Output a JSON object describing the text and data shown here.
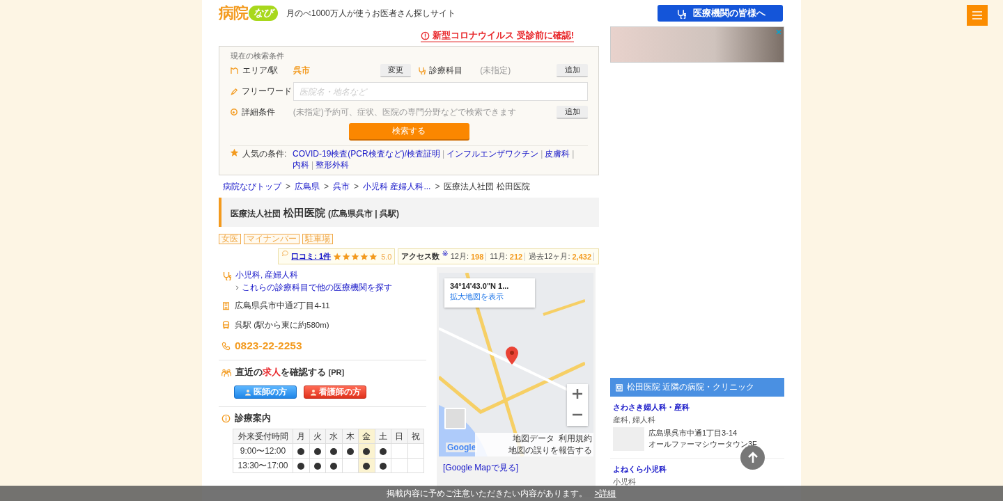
{
  "header": {
    "logo_main": "病院",
    "logo_badge": "なび",
    "tagline": "月のべ1000万人が使うお医者さん探しサイト",
    "provider_button": "医療機関の皆様へ",
    "covid_link": "新型コロナウイルス 受診前に確認!"
  },
  "search": {
    "title": "現在の検索条件",
    "area": {
      "label": "エリア/駅",
      "value": "呉市",
      "button": "変更"
    },
    "department": {
      "label": "診療科目",
      "value": "(未指定)",
      "button": "追加"
    },
    "freeword": {
      "label": "フリーワード",
      "placeholder": "医院名・地名など"
    },
    "detail": {
      "label": "詳細条件",
      "value": "(未指定)予約可、症状、医院の専門分野などで検索できます",
      "button": "追加"
    },
    "submit": "検索する",
    "popular": {
      "label": "人気の条件:",
      "separator": "|",
      "links": [
        "COVID-19検査(PCR検査など)/検査証明",
        "インフルエンザワクチン",
        "皮膚科",
        "内科",
        "整形外科"
      ]
    }
  },
  "breadcrumb": {
    "separator": ">",
    "items": [
      {
        "label": "病院なびトップ",
        "link": true
      },
      {
        "label": "広島県",
        "link": true
      },
      {
        "label": "呉市",
        "link": true
      },
      {
        "label": "小児科 産婦人科...",
        "link": true
      },
      {
        "label": "医療法人社団 松田医院",
        "link": false
      }
    ]
  },
  "clinic": {
    "corp": "医療法人社団",
    "name": "松田医院",
    "place": "(広島県呉市 | 呉駅)",
    "tags": [
      "女医",
      "マイナンバー",
      "駐車場"
    ],
    "review": {
      "link": "口コミ: 1件",
      "stars": 5,
      "score": "5.0"
    },
    "access": {
      "label": "アクセス数",
      "note": "※",
      "stats": [
        {
          "label": "12月:",
          "value": "198"
        },
        {
          "label": "11月:",
          "value": "212"
        },
        {
          "label": "過去12ヶ月:",
          "value": "2,432"
        }
      ]
    },
    "specialties": "小児科, 産婦人科",
    "search_link": "これらの診療科目で他の医療機関を探す",
    "address": "広島県呉市中通2丁目4-11",
    "station": "呉駅 (駅から東に約580m)",
    "phone": "0823-22-2253"
  },
  "jobs": {
    "before": "直近の",
    "highlight": "求人",
    "after": "を確認する",
    "pr": "[PR]",
    "buttons": [
      {
        "label": "医師の方",
        "kind": "doctor"
      },
      {
        "label": "看護師の方",
        "kind": "nurse"
      }
    ]
  },
  "schedule": {
    "title": "診療案内",
    "head": "外来受付時間",
    "days": [
      {
        "label": "月",
        "today": false
      },
      {
        "label": "火",
        "today": false
      },
      {
        "label": "水",
        "today": false
      },
      {
        "label": "木",
        "today": false
      },
      {
        "label": "金",
        "today": true
      },
      {
        "label": "土",
        "today": false
      },
      {
        "label": "日",
        "today": false
      },
      {
        "label": "祝",
        "today": false
      }
    ],
    "rows": [
      {
        "time": "9:00〜12:00",
        "open": [
          true,
          true,
          true,
          true,
          true,
          true,
          false,
          false
        ]
      },
      {
        "time": "13:30〜17:00",
        "open": [
          true,
          true,
          true,
          false,
          true,
          true,
          false,
          false
        ]
      }
    ]
  },
  "map": {
    "coords": "34°14'43.0\"N 1...",
    "enlarge_link": "拡大地図を表示",
    "logo": "Google",
    "footer_links": [
      "地図データ",
      "利用規約",
      "地図の誤りを報告する"
    ],
    "open_link": "[Google Mapで見る]"
  },
  "nearby": {
    "title": "松田医院 近隣の病院・クリニック",
    "items": [
      {
        "name": "さわさき婦人科・産科",
        "specialties": "産科, 婦人科",
        "address": [
          "広島県呉市中通1丁目3-14",
          "オールファーマシウータウン3F"
        ]
      },
      {
        "name": "よねくら小児科",
        "specialties": "小児科"
      }
    ]
  },
  "notice": {
    "text": "掲載内容に予めご注意いただきたい内容があります。",
    "link": ">詳細"
  }
}
